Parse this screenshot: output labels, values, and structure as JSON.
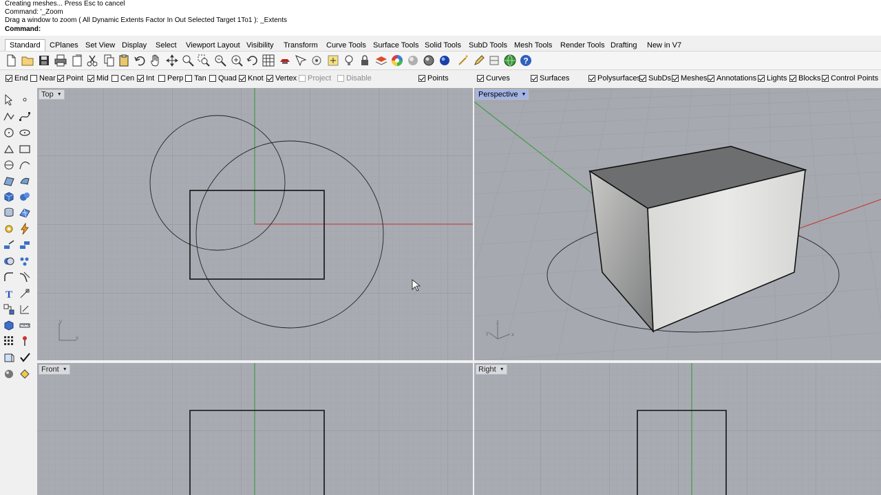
{
  "command_history": {
    "line1": "Creating meshes... Press Esc to cancel",
    "line2": "Command: '_Zoom",
    "line3": "Drag a window to zoom ( All  Dynamic  Extents  Factor  In  Out  Selected  Target  1To1 ): _Extents",
    "prompt": "Command:",
    "input_value": ""
  },
  "tabs": [
    "Standard",
    "CPlanes",
    "Set View",
    "Display",
    "Select",
    "Viewport Layout",
    "Visibility",
    "Transform",
    "Curve Tools",
    "Surface Tools",
    "Solid Tools",
    "SubD Tools",
    "Mesh Tools",
    "Render Tools",
    "Drafting",
    "New in V7"
  ],
  "active_tab": "Standard",
  "toolbar_icons": [
    "new-icon",
    "open-icon",
    "save-icon",
    "print-icon",
    "import-icon",
    "cut-icon",
    "copy-icon",
    "paste-icon",
    "undo-icon",
    "pan-hand-icon",
    "move-icon",
    "zoom-icon",
    "zoom-window-icon",
    "zoom-extents-icon",
    "zoom-selected-icon",
    "rotate-view-icon",
    "grid-icon",
    "lights-icon",
    "properties-icon",
    "object-snap-icon",
    "bulb-icon",
    "lock-icon",
    "layer-icon",
    "color-wheel-icon",
    "material-sphere-icon",
    "render-icon",
    "blue-sphere-icon",
    "wand-icon",
    "options-icon",
    "globe-icon",
    "help-icon"
  ],
  "osnaps": [
    {
      "label": "End",
      "checked": true
    },
    {
      "label": "Near",
      "checked": false
    },
    {
      "label": "Point",
      "checked": true
    },
    {
      "label": "Mid",
      "checked": true
    },
    {
      "label": "Cen",
      "checked": false
    },
    {
      "label": "Int",
      "checked": true
    },
    {
      "label": "Perp",
      "checked": false
    },
    {
      "label": "Tan",
      "checked": false
    },
    {
      "label": "Quad",
      "checked": false
    },
    {
      "label": "Knot",
      "checked": true
    },
    {
      "label": "Vertex",
      "checked": true
    },
    {
      "label": "Project",
      "checked": false,
      "disabled": true
    },
    {
      "label": "Disable",
      "checked": false,
      "disabled": true
    }
  ],
  "filters": [
    {
      "label": "Points",
      "checked": true
    },
    {
      "label": "Curves",
      "checked": true
    },
    {
      "label": "Surfaces",
      "checked": true
    },
    {
      "label": "Polysurfaces",
      "checked": true
    },
    {
      "label": "SubDs",
      "checked": true
    },
    {
      "label": "Meshes",
      "checked": true
    },
    {
      "label": "Annotations",
      "checked": true
    },
    {
      "label": "Lights",
      "checked": true
    },
    {
      "label": "Blocks",
      "checked": true
    },
    {
      "label": "Control Points",
      "checked": true
    }
  ],
  "viewports": {
    "top": {
      "title": "Top"
    },
    "perspective": {
      "title": "Perspective"
    },
    "front": {
      "title": "Front"
    },
    "right": {
      "title": "Right"
    }
  },
  "axis_labels": {
    "x": "x",
    "y": "y",
    "z": "z"
  },
  "colors": {
    "x_axis": "#c8322f",
    "y_axis": "#2e9a2e",
    "viewport_bg": "#a8abb2",
    "active_title": "#a5b4e6"
  }
}
